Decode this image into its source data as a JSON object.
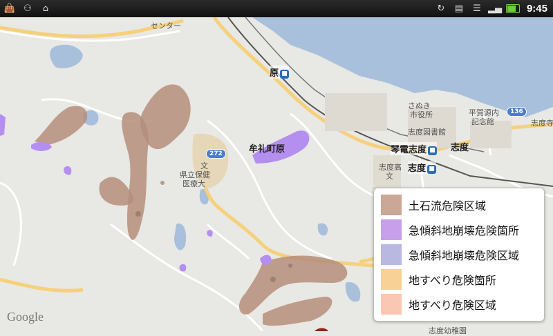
{
  "status_bar": {
    "time": "9:45",
    "left_icons": [
      "bag-icon",
      "usb-icon",
      "android-icon"
    ],
    "right_icons": [
      "sync-icon",
      "sdcard-icon",
      "vibrate-icon",
      "signal-icon",
      "battery-icon"
    ]
  },
  "map": {
    "watermark": "Google",
    "labels": [
      {
        "text": "センター",
        "key": "center"
      },
      {
        "text": "牟礼町原",
        "key": "mure"
      },
      {
        "text": "文",
        "key": "bun"
      },
      {
        "text": "県立保健",
        "key": "hoken1"
      },
      {
        "text": "医療大",
        "key": "hoken2"
      },
      {
        "text": "さぬき",
        "key": "sanuki"
      },
      {
        "text": "市役所",
        "key": "shiyakusho"
      },
      {
        "text": "平賀源内",
        "key": "hiraga1"
      },
      {
        "text": "記念館",
        "key": "hiraga2"
      },
      {
        "text": "志度寺",
        "key": "shidoji"
      },
      {
        "text": "志度図書館",
        "key": "tosho"
      },
      {
        "text": "志度",
        "key": "shido"
      },
      {
        "text": "志度高",
        "key": "shidoko"
      },
      {
        "text": "文",
        "key": "bun2"
      },
      {
        "text": "志度幼稚園",
        "key": "yochien"
      }
    ],
    "stations": [
      {
        "text": "原",
        "key": "hara"
      },
      {
        "text": "琴電志度",
        "key": "kotoden"
      },
      {
        "text": "志度",
        "key": "shido_st"
      }
    ],
    "road_badges": [
      "272",
      "136"
    ]
  },
  "legend": {
    "items": [
      {
        "label": "土石流危険区域",
        "color": "#caa796"
      },
      {
        "label": "急傾斜地崩壊危険箇所",
        "color": "#c79fea"
      },
      {
        "label": "急傾斜地崩壊危険区域",
        "color": "#b9b8e1"
      },
      {
        "label": "地すべり危険箇所",
        "color": "#f8d197"
      },
      {
        "label": "地すべり危険区域",
        "color": "#fac7b2"
      }
    ]
  },
  "colors": {
    "land": "#e8e8e4",
    "water": "#a8c0dc",
    "road_major": "#f6d07a",
    "road_minor": "#ffffff",
    "debris_area": "#b58e7b",
    "slope_point": "#b58ff0",
    "rail": "#555555"
  }
}
